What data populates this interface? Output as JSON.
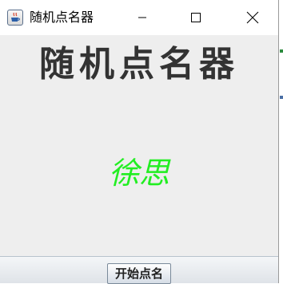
{
  "window": {
    "title": "随机点名器",
    "controls": {
      "minimize_icon": "minimize-icon",
      "maximize_icon": "maximize-icon",
      "close_icon": "close-icon"
    }
  },
  "main": {
    "heading": "随机点名器",
    "picked_name": "徐思",
    "picked_name_color": "#22ee22"
  },
  "footer": {
    "start_button_label": "开始点名"
  }
}
